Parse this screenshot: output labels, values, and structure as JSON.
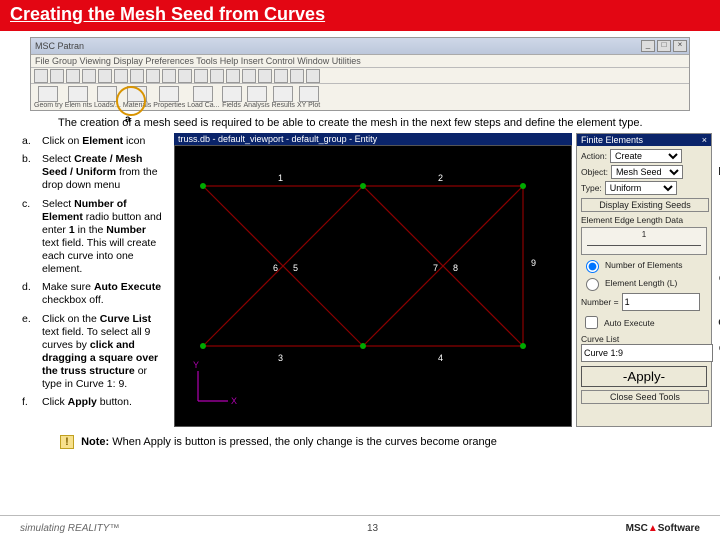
{
  "title": "Creating the Mesh Seed from Curves",
  "intro": "The creation of a mesh seed is required to be able to create the mesh in the next few steps and define the element type.",
  "app": {
    "title": "MSC Patran",
    "menu": "File  Group  Viewing  Display  Preferences  Tools  Help  Insert Control  Window  Utilities",
    "tabs": [
      "Geom try",
      "Elem nts",
      "Loads/...",
      "Materials",
      "Properties",
      "Load Ca...",
      "Fields",
      "Analysis",
      "Results",
      "XY Plot"
    ]
  },
  "steps": [
    {
      "id": "a.",
      "html": "Click on <b>Element</b> icon"
    },
    {
      "id": "b.",
      "html": "Select <b>Create / Mesh Seed / Uniform</b> from the drop down menu"
    },
    {
      "id": "c.",
      "html": "Select <b>Number of Element</b> radio button and enter <b>1</b> in the <b>Number</b> text field. This will create each curve into one element."
    },
    {
      "id": "d.",
      "html": "Make sure <b>Auto Execute</b> checkbox off."
    },
    {
      "id": "e.",
      "html": "Click on the <b>Curve List</b> text field. To select all 9 curves by <b>click and dragging a square over the truss structure</b> or type in Curve 1: 9."
    },
    {
      "id": "f.",
      "html": "Click <b>Apply</b> button."
    }
  ],
  "viewport": {
    "header": "truss.db - default_viewport - default_group - Entity"
  },
  "panel": {
    "title": "Finite Elements",
    "action_label": "Action:",
    "action": "Create",
    "object_label": "Object:",
    "object": "Mesh Seed",
    "type_label": "Type:",
    "type": "Uniform",
    "existing_btn": "Display Existing Seeds",
    "elem_edge_label": "Element Edge Length Data",
    "radio_num": "Number of Elements",
    "radio_len": "Element Length (L)",
    "number_label": "Number =",
    "number_value": "1",
    "auto_exec": "Auto Execute",
    "curve_list_label": "Curve List",
    "curve_list_value": "Curve 1:9",
    "apply": "-Apply-",
    "close_btn": "Close Seed Tools"
  },
  "callouts": {
    "a": "a",
    "b": "b",
    "c": "c",
    "d": "d",
    "e": "e"
  },
  "note_label": "Note:",
  "note": "When Apply is button is pressed, the only change is the curves become orange",
  "footer": {
    "left": "simulating REALITY™",
    "page": "13",
    "logo_pre": "MSC",
    "logo_suf": "Software"
  }
}
